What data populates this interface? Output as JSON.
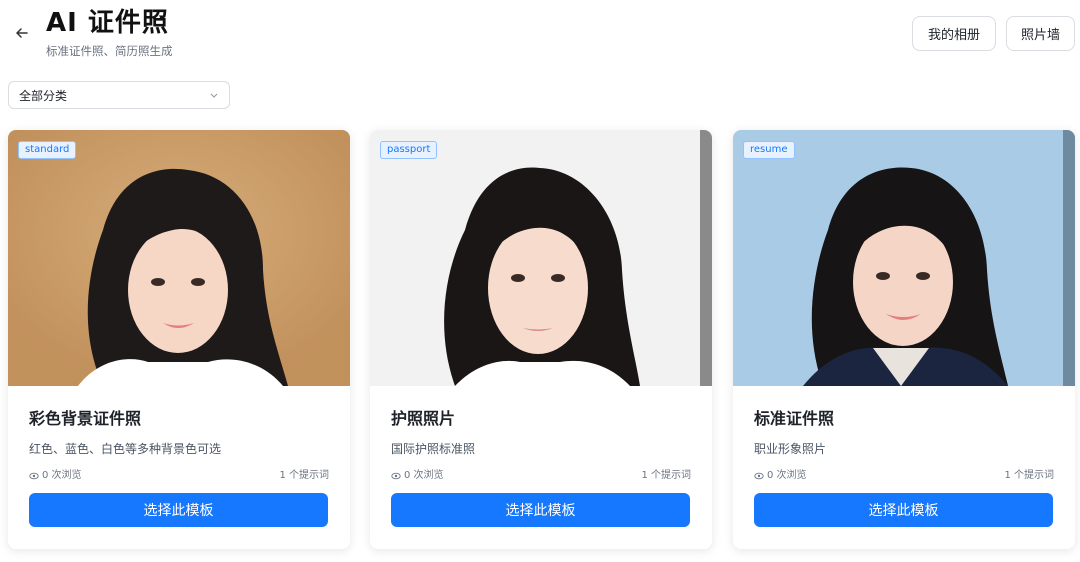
{
  "header": {
    "title": "AI 证件照",
    "subtitle": "标准证件照、简历照生成",
    "album_label": "我的相册",
    "wall_label": "照片墙",
    "back_icon": "arrow-left-icon"
  },
  "filter": {
    "selected": "全部分类",
    "icon": "chevron-down-icon"
  },
  "cards": [
    {
      "tag": "standard",
      "title": "彩色背景证件照",
      "desc": "红色、蓝色、白色等多种背景色可选",
      "views": "0 次浏览",
      "prompts": "1 个提示词",
      "button": "选择此模板",
      "bg_color": "#c89a66"
    },
    {
      "tag": "passport",
      "title": "护照照片",
      "desc": "国际护照标准照",
      "views": "0 次浏览",
      "prompts": "1 个提示词",
      "button": "选择此模板",
      "bg_color": "#f2f2f2"
    },
    {
      "tag": "resume",
      "title": "标准证件照",
      "desc": "职业形象照片",
      "views": "0 次浏览",
      "prompts": "1 个提示词",
      "button": "选择此模板",
      "bg_color": "#a9cbe6"
    }
  ],
  "colors": {
    "primary": "#1677ff",
    "tag_bg": "#e8f2ff"
  }
}
